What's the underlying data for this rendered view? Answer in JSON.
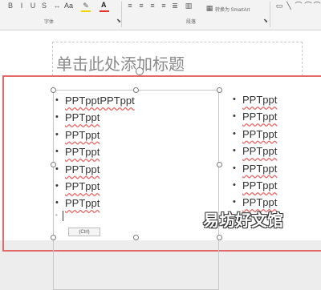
{
  "ribbon": {
    "font_group_label": "字体",
    "paragraph_group_label": "段落",
    "smartart_label": "转换为 SmartArt",
    "font_color_label": "A",
    "highlight_label": "Aa",
    "accent_red": "#e0322e",
    "accent_yellow": "#f2d600"
  },
  "slide": {
    "title_placeholder": "单击此处添加标题",
    "left_bullets": [
      "PPTpptPPTppt",
      "PPTppt",
      "PPTppt",
      "PPTppt",
      "PPTppt",
      "PPTppt",
      "PPTppt"
    ],
    "right_bullets": [
      "PPTppt",
      "PPTppt",
      "PPTppt",
      "PPTppt",
      "PPTppt",
      "PPTppt",
      "PPTppt"
    ],
    "bullet_char": "•",
    "empty_bullet_char": "•",
    "paste_options_label": "(Ctrl)"
  },
  "watermark": "易坊好文馆",
  "colors": {
    "selection_frame": "#e46a6a",
    "placeholder_text": "#8a8a8a"
  }
}
